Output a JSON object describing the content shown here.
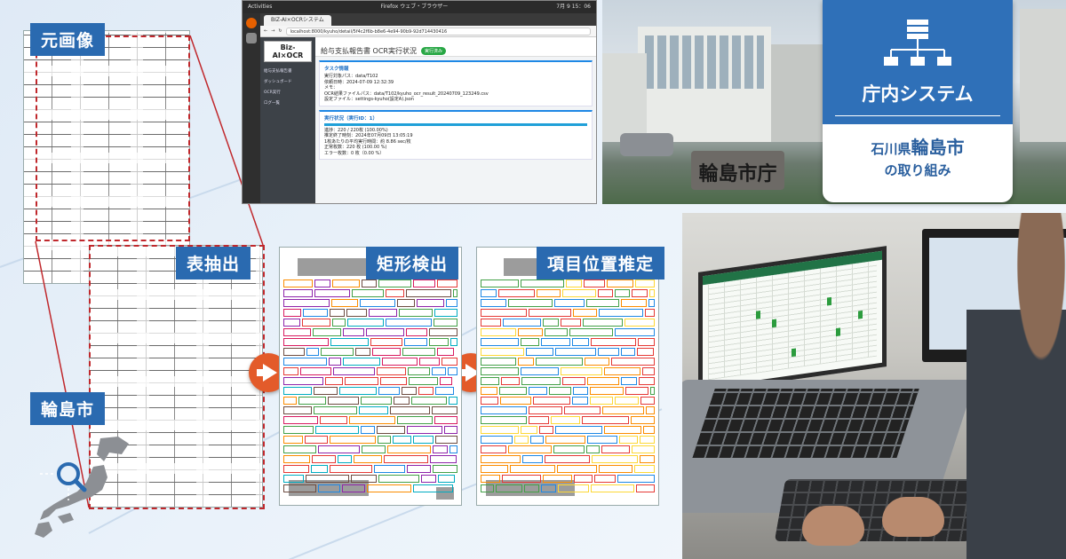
{
  "labels": {
    "original": "元画像",
    "table_extract": "表抽出",
    "rect_detect": "矩形検出",
    "item_position": "項目位置推定",
    "city": "輪島市"
  },
  "browser": {
    "os_left": "Activities",
    "os_app": "Firefox ウェブ・ブラウザー",
    "os_time": "7月 9 15：06",
    "tab_title": "BIZ-AI×OCRシステム",
    "url": "localhost:8000/kyuho/detail/5f4c2f6b-b8e6-4e94-90b9-92d714430416",
    "brand": "Biz-AI×OCR",
    "sidebar": [
      "給与支払報告書",
      "ダッシュボード",
      "OCR実行",
      "ログ一覧"
    ],
    "page_title": "給与支払報告書 OCR実行状況",
    "status_pill": "実行済み",
    "task_card": {
      "heading": "タスク情報",
      "lines": [
        "実行対象パス：data/T102",
        "依頼日時：2024-07-09 12:32:39",
        "メモ：",
        "OCR結果ファイルパス：data/T102/kyuho_ocr_result_20240709_123249.csv",
        "設定ファイル：settings-kyuho(設定A).json"
      ]
    },
    "run_card": {
      "heading": "実行状況（実行ID：1）",
      "lines": [
        "進捗：220 / 220枚 (100.00%)",
        "推定終了時刻：2024年07月09日 13:05:19",
        "1枚あたりの平均実行時間：約 8.86 sec/枚",
        "正常枚数：220 枚 (100.00 %)",
        "エラー枚数：0 枚（0.00 %）"
      ],
      "progress_percent": 100
    }
  },
  "photo": {
    "sign": "輪島市庁"
  },
  "system_card": {
    "title": "庁内システム",
    "line1_prefix": "石川県",
    "line1_city": "輪島市",
    "line2": "の取り組み",
    "accent": "#2f70b8"
  },
  "colors": {
    "label_bg": "#2a6ab0",
    "arrow": "#e35b2a",
    "dashed_outline": "#c0282c"
  }
}
